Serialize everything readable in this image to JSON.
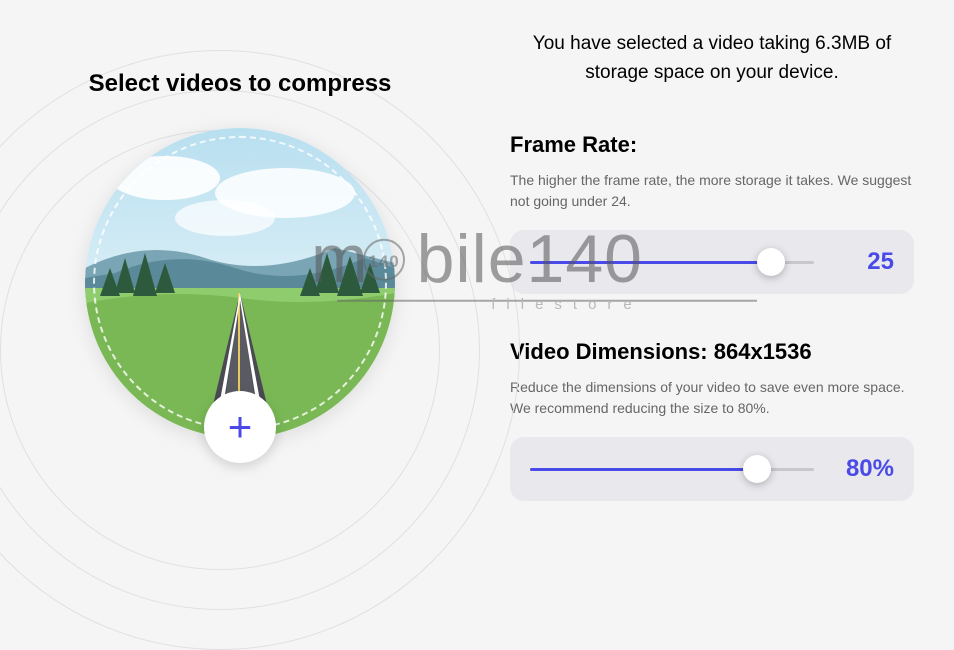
{
  "left": {
    "title": "Select videos to compress"
  },
  "info": {
    "text": "You have selected a video taking 6.3MB of storage space on your device."
  },
  "frameRate": {
    "title": "Frame Rate:",
    "description": "The higher the frame rate, the more storage it takes. We suggest not going under 24.",
    "value": "25",
    "fillPercent": "85%"
  },
  "dimensions": {
    "title": "Video Dimensions: 864x1536",
    "description": "Reduce the dimensions of your video to save even more space. We recommend reducing the size to 80%.",
    "value": "80%",
    "fillPercent": "80%"
  },
  "watermark": {
    "main": "mobile140",
    "sub": "filestore"
  }
}
